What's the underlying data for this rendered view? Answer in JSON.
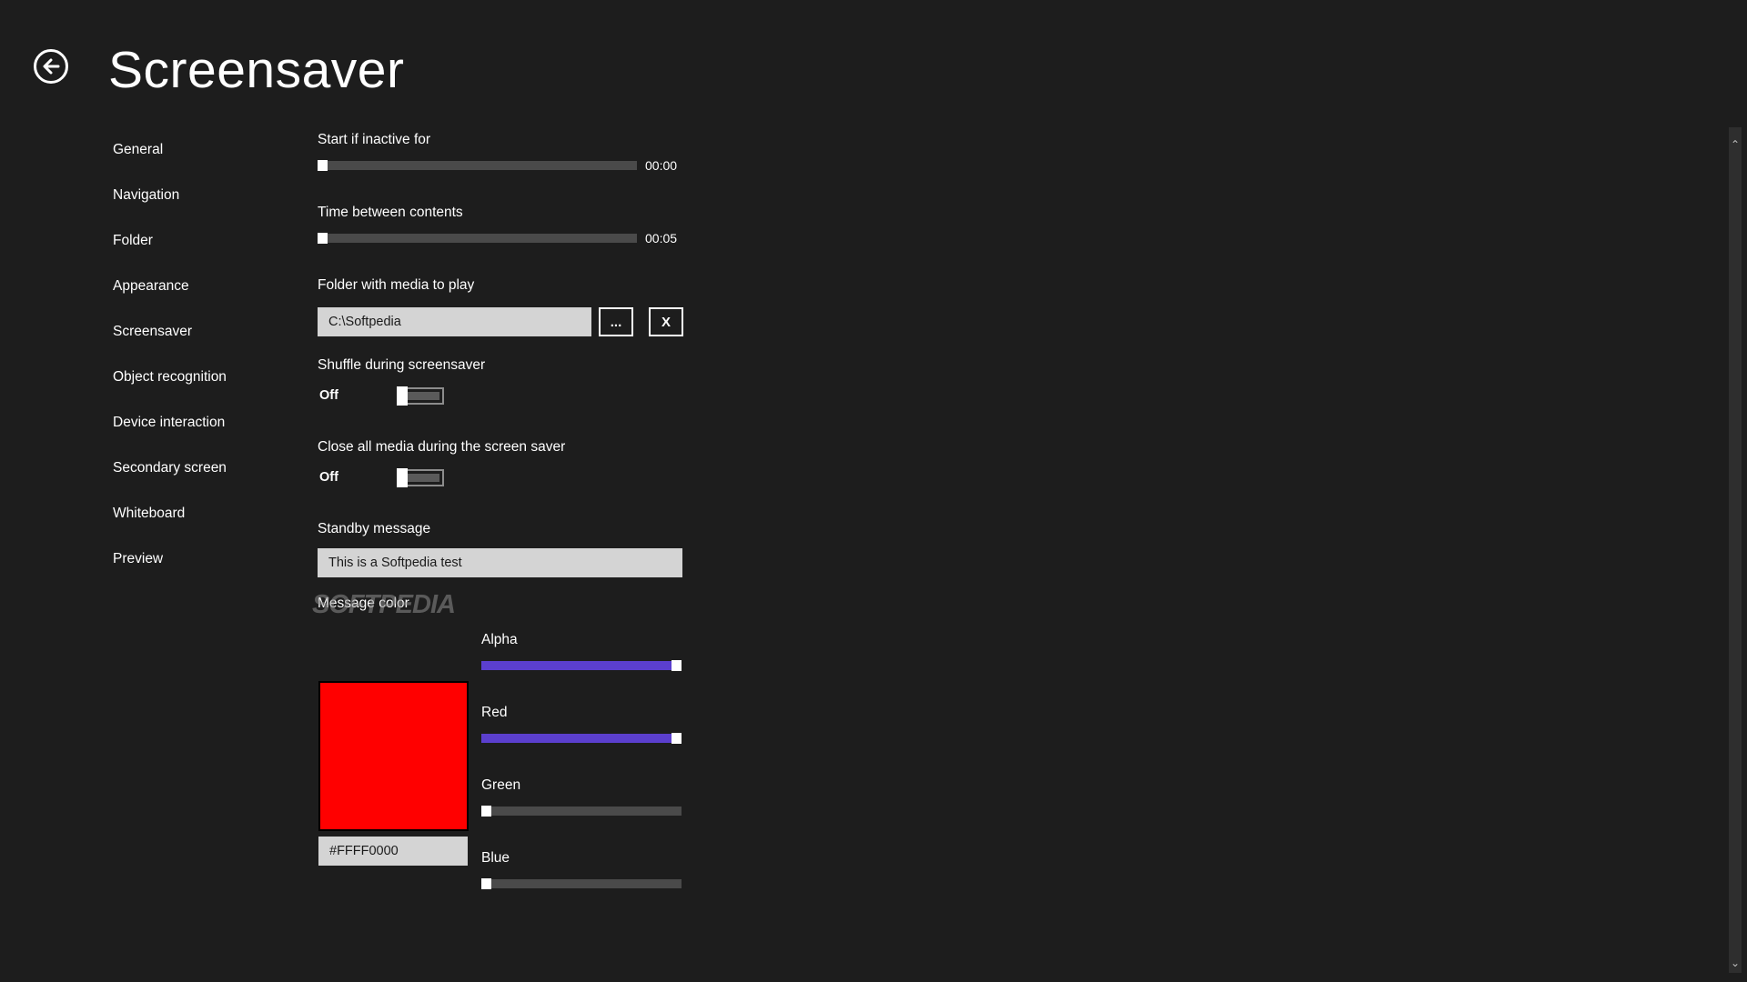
{
  "header": {
    "title": "Screensaver",
    "back_icon": "back-arrow-circle-icon"
  },
  "nav": {
    "items": [
      {
        "label": "General"
      },
      {
        "label": "Navigation"
      },
      {
        "label": "Folder"
      },
      {
        "label": "Appearance"
      },
      {
        "label": "Screensaver"
      },
      {
        "label": "Object recognition"
      },
      {
        "label": "Device interaction"
      },
      {
        "label": "Secondary screen"
      },
      {
        "label": "Whiteboard"
      },
      {
        "label": "Preview"
      }
    ]
  },
  "settings": {
    "start_inactive": {
      "label": "Start if inactive for",
      "value": "00:00",
      "fraction": 0.0
    },
    "time_between": {
      "label": "Time between contents",
      "value": "00:05",
      "fraction": 0.0
    },
    "folder": {
      "label": "Folder with media to play",
      "value": "C:\\Softpedia",
      "browse_label": "...",
      "clear_label": "X"
    },
    "shuffle": {
      "label": "Shuffle during screensaver",
      "state": "Off"
    },
    "close_media": {
      "label": "Close all media during the screen saver",
      "state": "Off"
    },
    "standby": {
      "label": "Standby message",
      "value": "This is a Softpedia test"
    },
    "message_color": {
      "label": "Message color",
      "hex": "#FFFF0000",
      "swatch_color": "#ff0000",
      "channels": [
        {
          "label": "Alpha",
          "fraction": 1.0
        },
        {
          "label": "Red",
          "fraction": 1.0
        },
        {
          "label": "Green",
          "fraction": 0.0
        },
        {
          "label": "Blue",
          "fraction": 0.0
        }
      ]
    }
  },
  "watermark": "SOFTPEDIA",
  "colors": {
    "background": "#1d1d1d",
    "accent": "#5b3fce",
    "track": "#4a4a4a"
  }
}
